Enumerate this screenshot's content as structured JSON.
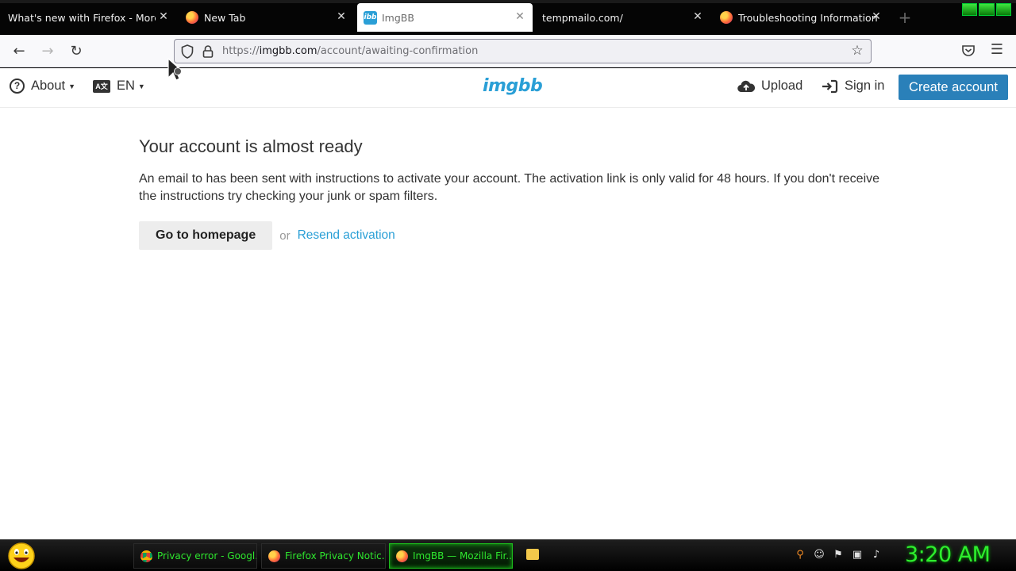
{
  "browser": {
    "tabs": [
      {
        "title": "What's new with Firefox - More priv",
        "icon": "none",
        "active": false
      },
      {
        "title": "New Tab",
        "icon": "firefox-icon",
        "active": false
      },
      {
        "title": "ImgBB",
        "icon": "imgbb-icon",
        "active": true
      },
      {
        "title": "tempmailo.com/",
        "icon": "none",
        "active": false
      },
      {
        "title": "Troubleshooting Information",
        "icon": "firefox-icon",
        "active": false
      }
    ],
    "close_glyph": "✕",
    "newtab_glyph": "+",
    "url_prefix": "https://",
    "url_host": "imgbb.com",
    "url_path": "/account/awaiting-confirmation",
    "imgbb_icon_text": "ibb"
  },
  "site": {
    "header": {
      "about": "About",
      "lang": "EN",
      "logo": "imgbb",
      "upload": "Upload",
      "signin": "Sign in",
      "create_account": "Create account"
    },
    "main": {
      "title": "Your account is almost ready",
      "message": "An email to has been sent with instructions to activate your account. The activation link is only valid for 48 hours. If you don't receive the instructions try checking your junk or spam filters.",
      "home_button": "Go to homepage",
      "or": "or",
      "resend_link": "Resend activation"
    }
  },
  "taskbar": {
    "items": [
      {
        "label": "Privacy error - Googl...",
        "icon": "chrome-icon"
      },
      {
        "label": "Firefox Privacy Notic...",
        "icon": "firefox-icon"
      },
      {
        "label": "ImgBB — Mozilla Fir...",
        "icon": "firefox-icon",
        "active": true
      }
    ],
    "clock": "3:20 AM"
  },
  "colors": {
    "brand": "#2a9fd6",
    "create_button": "#2a80b9",
    "taskbar_text": "#2ee62e"
  }
}
